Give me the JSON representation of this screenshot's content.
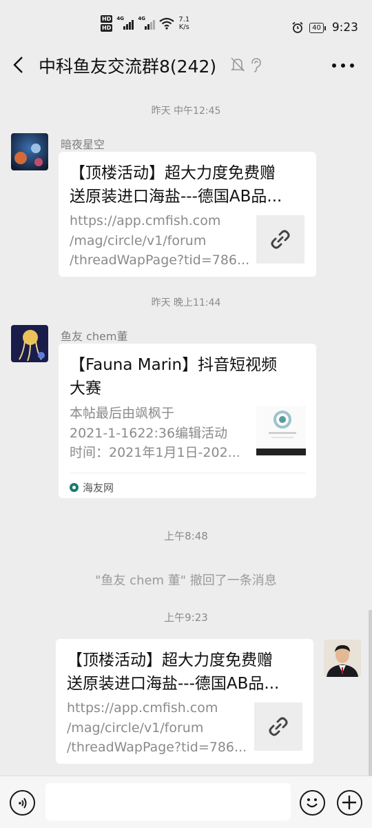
{
  "status_bar": {
    "network_speed_value": "7.1",
    "network_speed_unit": "K/s",
    "signal_label_1": "4G",
    "signal_label_2": "4G",
    "hd_label": "HD",
    "battery": "40",
    "time": "9:23",
    "icons": [
      "hd-icon",
      "signal-icon",
      "wifi-icon",
      "alarm-icon",
      "battery-icon"
    ]
  },
  "header": {
    "title": "中科鱼友交流群8(242)",
    "icons": [
      "back-icon",
      "mute-bell-icon",
      "earpiece-icon",
      "more-icon"
    ]
  },
  "messages": [
    {
      "timestamp": "昨天 中午12:45",
      "sender": "暗夜星空",
      "card_title": "【顶楼活动】超大力度免费赠送原装进口海盐---德国AB品...",
      "card_title_lines": [
        "【顶楼活动】超大力度免费赠",
        "送原装进口海盐---德国AB品..."
      ],
      "card_desc_lines": [
        "https://app.cmfish.com",
        "/mag/circle/v1/forum",
        "/threadWapPage?tid=786..."
      ],
      "thumb": "link-icon"
    },
    {
      "timestamp": "昨天 晚上11:44",
      "sender": "鱼友 chem董",
      "card_title_lines": [
        "【Fauna Marin】抖音短视频",
        "大赛"
      ],
      "card_desc_lines": [
        "本帖最后由飒枫于",
        "2021-1-1622:36编辑活动",
        "时间：2021年1月1日-202..."
      ],
      "source": "海友网",
      "thumb": "poster-image"
    },
    {
      "timestamp": "上午8:48",
      "system_text": "\"鱼友 chem 董\" 撤回了一条消息"
    },
    {
      "timestamp": "上午9:23",
      "card_title_lines": [
        "【顶楼活动】超大力度免费赠",
        "送原装进口海盐---德国AB品..."
      ],
      "card_desc_lines": [
        "https://app.cmfish.com",
        "/mag/circle/v1/forum",
        "/threadWapPage?tid=786..."
      ],
      "thumb": "link-icon",
      "own": true
    }
  ],
  "input_bar": {
    "placeholder": "",
    "icons": [
      "voice-icon",
      "emoji-icon",
      "plus-icon"
    ]
  },
  "colors": {
    "background": "#ededed",
    "card": "#ffffff",
    "timestamp": "#8a8a8a"
  }
}
